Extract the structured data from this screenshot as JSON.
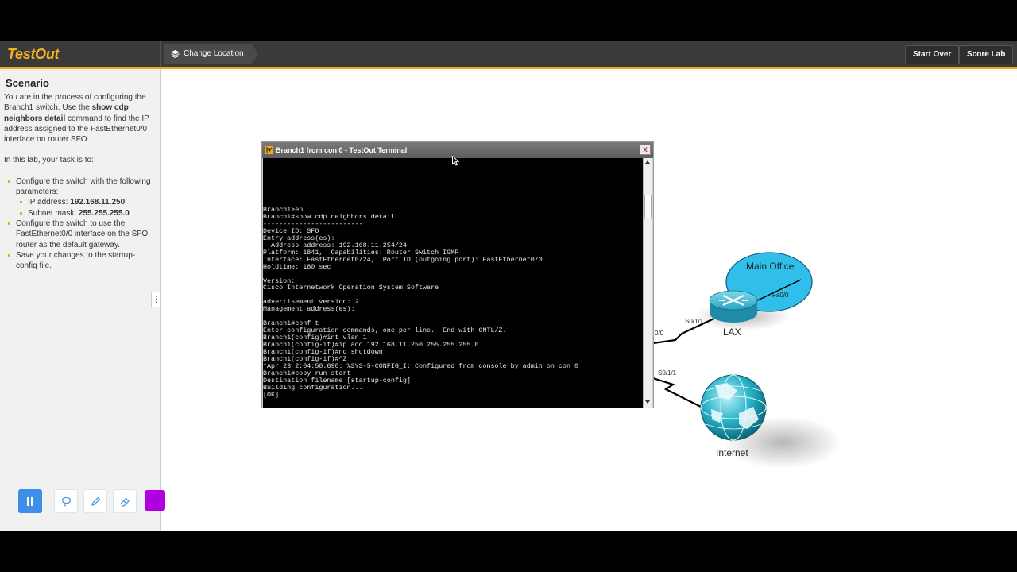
{
  "app": {
    "logo": "TestOut",
    "breadcrumb": "Change Location",
    "start_over": "Start Over",
    "score_lab": "Score Lab"
  },
  "sidebar": {
    "title": "Scenario",
    "intro_1": "You are in the process of configuring the Branch1 switch. Use the ",
    "intro_cmd": "show cdp neighbors detail",
    "intro_2": " command to find the IP address assigned to the FastEthernet0/0 interface on router SFO.",
    "task_intro": "In this lab, your task is to:",
    "task_1": "Configure the switch with the following parameters:",
    "ip_label": "IP address: ",
    "ip_value": "192.168.11.250",
    "mask_label": "Subnet mask: ",
    "mask_value": "255.255.255.0",
    "task_2": "Configure the switch to use the FastEthernet0/0 interface on the SFO router as the default gateway.",
    "task_3": "Save your changes to the startup-config file.",
    "handle": "⋮"
  },
  "tools": {
    "pause_icon": "pause-icon",
    "lasso_icon": "lasso-icon",
    "pencil_icon": "pencil-icon",
    "eraser_icon": "eraser-icon",
    "color": "#b000e0"
  },
  "terminal": {
    "title": "Branch1 from con 0 - TestOut Terminal",
    "close": "x",
    "output": "Branch1>en\nBranch1#show cdp neighbors detail\n-------------------------\nDevice ID: SFO\nEntry address(es):\n  Address address: 192.168.11.254/24\nPlatform: 1841,  Capabilities: Router Switch IGMP\nInterface: FastEthernet0/24,  Port ID (outgoing port): FastEthernet0/0\nHoldtime: 180 sec\n\nVersion:\nCisco Internetwork Operation System Software\n\nadvertisement version: 2\nManagement address(es):\n\nBranch1#conf t\nEnter configuration commands, one per line.  End with CNTL/Z.\nBranch1(config)#int vlan 1\nBranch1(config-if)#ip add 192.168.11.250 255.255.255.0\nBranch1(config-if)#no shutdown\nBranch1(config-if)#^Z\n*Apr 23 2:04:50.690: %SYS-5-CONFIG_I: Configured from console by admin on con 0\nBranch1#copy run start\nDestination filename [startup-config]\nBuilding configuration...\n[OK]"
  },
  "network": {
    "main_office": "Main Office",
    "fa_port": "Fa0/0",
    "lax": "LAX",
    "s011_top": "S0/1/1",
    "s00_partial": "0/0",
    "s011_bottom": "S0/1/1",
    "internet": "Internet"
  }
}
